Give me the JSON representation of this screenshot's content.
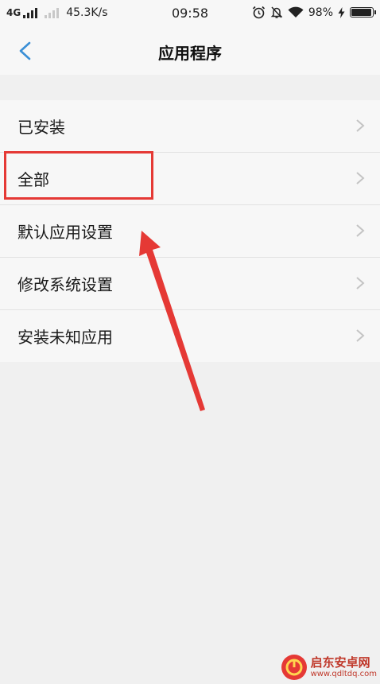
{
  "status_bar": {
    "network": "4G",
    "speed": "45.3K/s",
    "time": "09:58",
    "battery": "98%",
    "battery_fill": 0.98
  },
  "header": {
    "title": "应用程序"
  },
  "menu": {
    "items": [
      {
        "label": "已安装"
      },
      {
        "label": "全部"
      },
      {
        "label": "默认应用设置"
      },
      {
        "label": "修改系统设置"
      },
      {
        "label": "安装未知应用"
      }
    ]
  },
  "watermark": {
    "name": "启东安卓网",
    "url": "www.qdltdq.com"
  },
  "colors": {
    "accent": "#3a8fd6",
    "annotation": "#e53935",
    "background": "#f0f0f0",
    "surface": "#f7f7f7"
  }
}
